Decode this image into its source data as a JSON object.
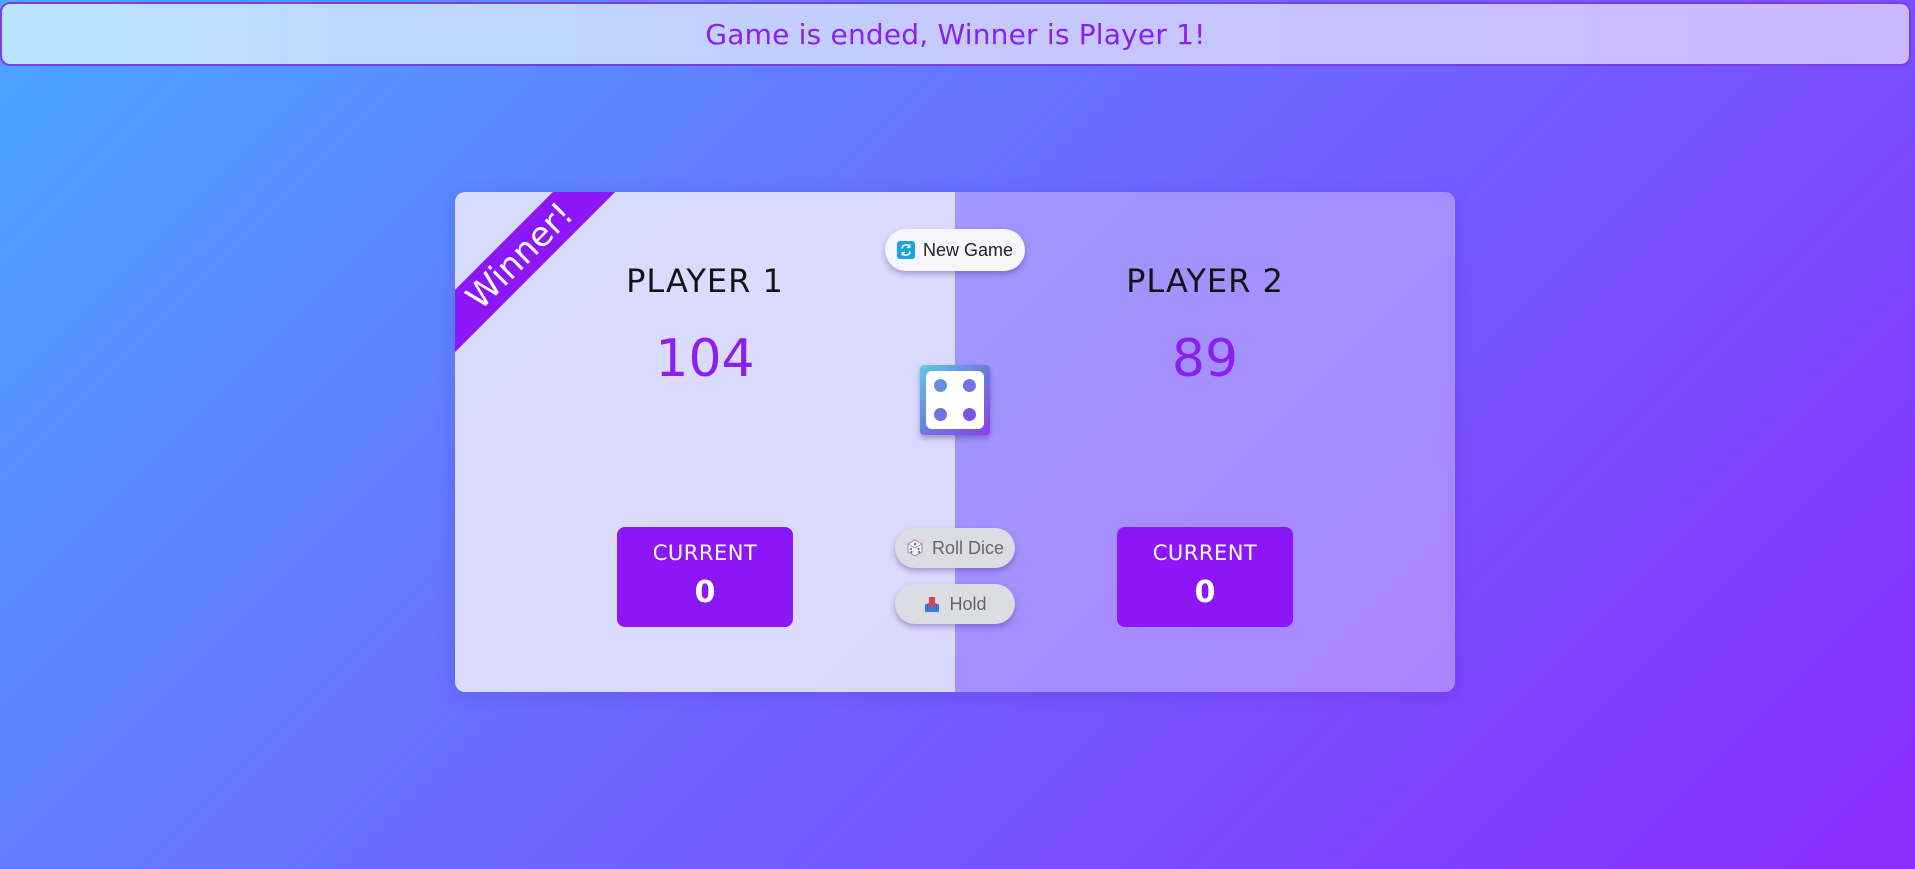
{
  "banner": {
    "message": "Game is ended, Winner is Player 1!"
  },
  "controls": {
    "new_game_label": "New Game",
    "roll_dice_label": "Roll Dice",
    "hold_label": "Hold",
    "new_game_icon": "refresh-icon",
    "roll_dice_icon": "dice-icon",
    "hold_icon": "hold-icon"
  },
  "players": [
    {
      "name": "PLAYER 1",
      "score": "104",
      "current_label": "CURRENT",
      "current_score": "0",
      "winner_label": "Winner!"
    },
    {
      "name": "PLAYER 2",
      "score": "89",
      "current_label": "CURRENT",
      "current_score": "0"
    }
  ],
  "dice": {
    "value": 4
  },
  "colors": {
    "accent": "#8c16f7",
    "banner_text": "#8a1ff0",
    "score_text": "#8a1ff0"
  }
}
